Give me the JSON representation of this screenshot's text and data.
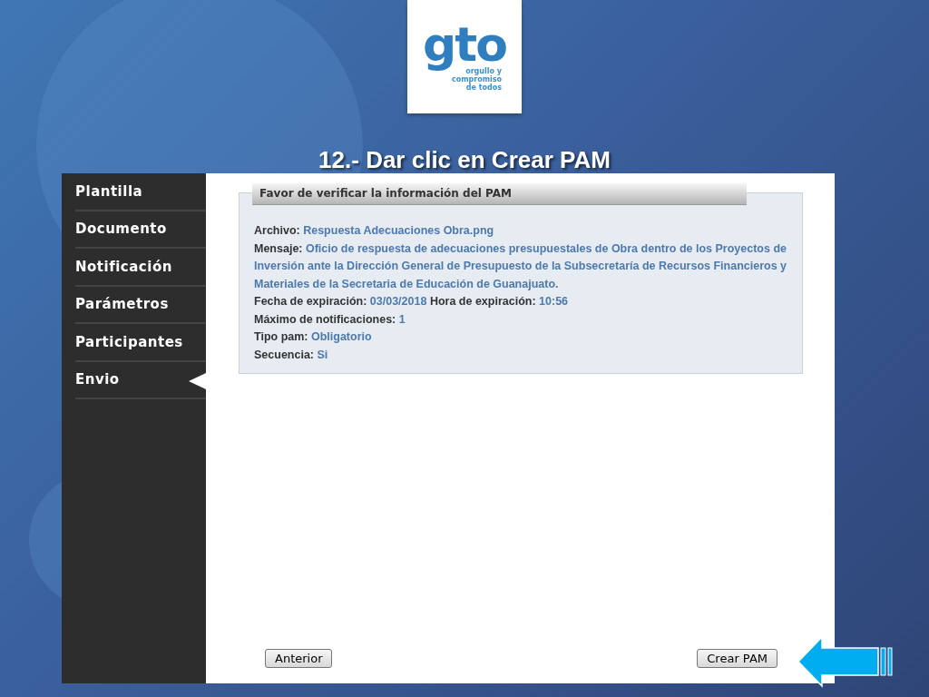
{
  "logo": {
    "wordmark": "gto",
    "tagline": [
      "orgullo y",
      "compromiso",
      "de todos"
    ]
  },
  "slide_title": "12.- Dar clic en Crear PAM",
  "sidebar": {
    "items": [
      {
        "label": "Plantilla",
        "selected": false
      },
      {
        "label": "Documento",
        "selected": false
      },
      {
        "label": "Notificación",
        "selected": false
      },
      {
        "label": "Parámetros",
        "selected": false
      },
      {
        "label": "Participantes",
        "selected": false
      },
      {
        "label": "Envio",
        "selected": true
      }
    ]
  },
  "panel": {
    "title": "Favor de verificar la información del PAM",
    "lines": [
      {
        "parts": [
          {
            "label": "Archivo:",
            "value": "Respuesta Adecuaciones Obra.png"
          }
        ]
      },
      {
        "parts": [
          {
            "label": "Mensaje:",
            "value": "Oficio de respuesta de adecuaciones presupuestales de Obra dentro de los Proyectos de Inversión ante la Dirección General de Presupuesto de la Subsecretaría de Recursos Financieros y Materiales de la Secretaria de Educación de Guanajuato."
          }
        ]
      },
      {
        "parts": [
          {
            "label": "Fecha de expiración:",
            "value": "03/03/2018"
          },
          {
            "label": "Hora de expiración:",
            "value": "10:56"
          }
        ]
      },
      {
        "parts": [
          {
            "label": "Máximo de notificaciones:",
            "value": "1"
          }
        ]
      },
      {
        "parts": [
          {
            "label": "Tipo pam:",
            "value": "Obligatorio"
          }
        ]
      },
      {
        "parts": [
          {
            "label": "Secuencia:",
            "value": "Si"
          }
        ]
      }
    ]
  },
  "buttons": [
    {
      "label": "Anterior"
    },
    {
      "label": "Crear PAM"
    }
  ]
}
